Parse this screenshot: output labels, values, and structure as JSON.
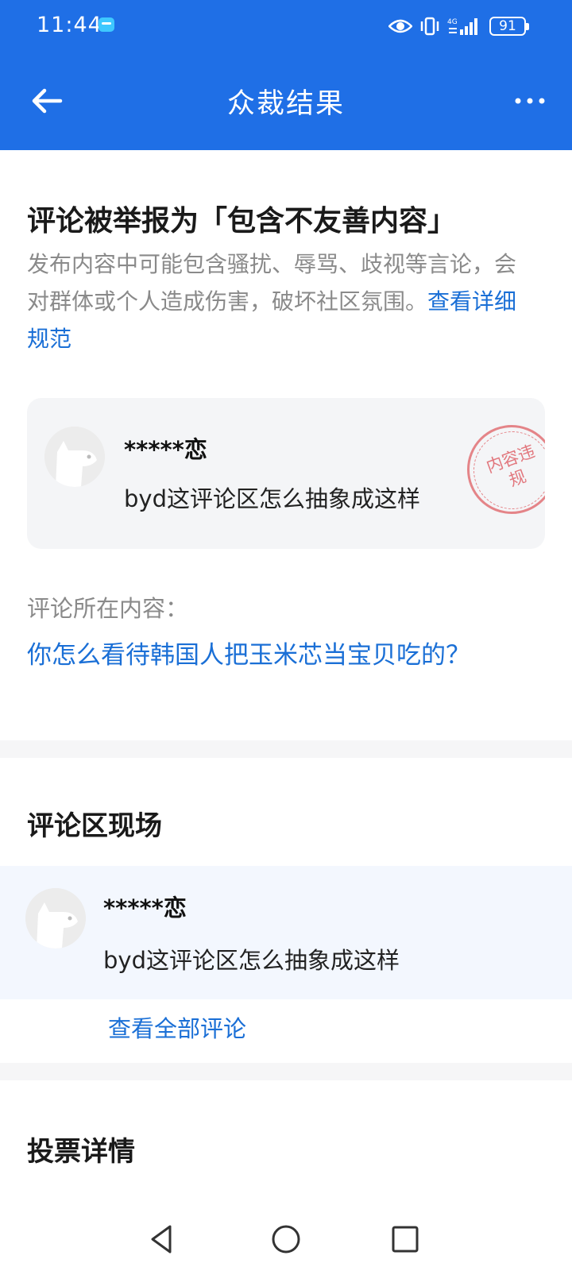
{
  "status_bar": {
    "time": "11:44",
    "battery": "91",
    "icons": [
      "message-icon",
      "eye-icon",
      "vibrate-icon",
      "signal-4g-icon",
      "battery-icon"
    ]
  },
  "header": {
    "title": "众裁结果",
    "back_icon": "arrow-left-icon",
    "more_icon": "more-horizontal-icon",
    "color": "#1f6fe6"
  },
  "report": {
    "title": "评论被举报为「包含不友善内容」",
    "description": "发布内容中可能包含骚扰、辱骂、歧视等言论，会对群体或个人造成伤害，破坏社区氛围。",
    "rules_link": "查看详细规范",
    "comment": {
      "user": "*****恋",
      "text": "byd这评论区怎么抽象成这样",
      "stamp": "内容违规"
    },
    "context_label": "评论所在内容：",
    "context_title": "你怎么看待韩国人把玉米芯当宝贝吃的？"
  },
  "comment_section": {
    "title": "评论区现场",
    "comment": {
      "user": "*****恋",
      "text": "byd这评论区怎么抽象成这样"
    },
    "view_all": "查看全部评论"
  },
  "vote_section": {
    "title": "投票详情"
  },
  "nav": {
    "icons": [
      "back-triangle-icon",
      "home-circle-icon",
      "recents-square-icon"
    ]
  },
  "colors": {
    "accent": "#1f6fe6",
    "link": "#1a6fd6",
    "stamp": "#e3787c"
  }
}
